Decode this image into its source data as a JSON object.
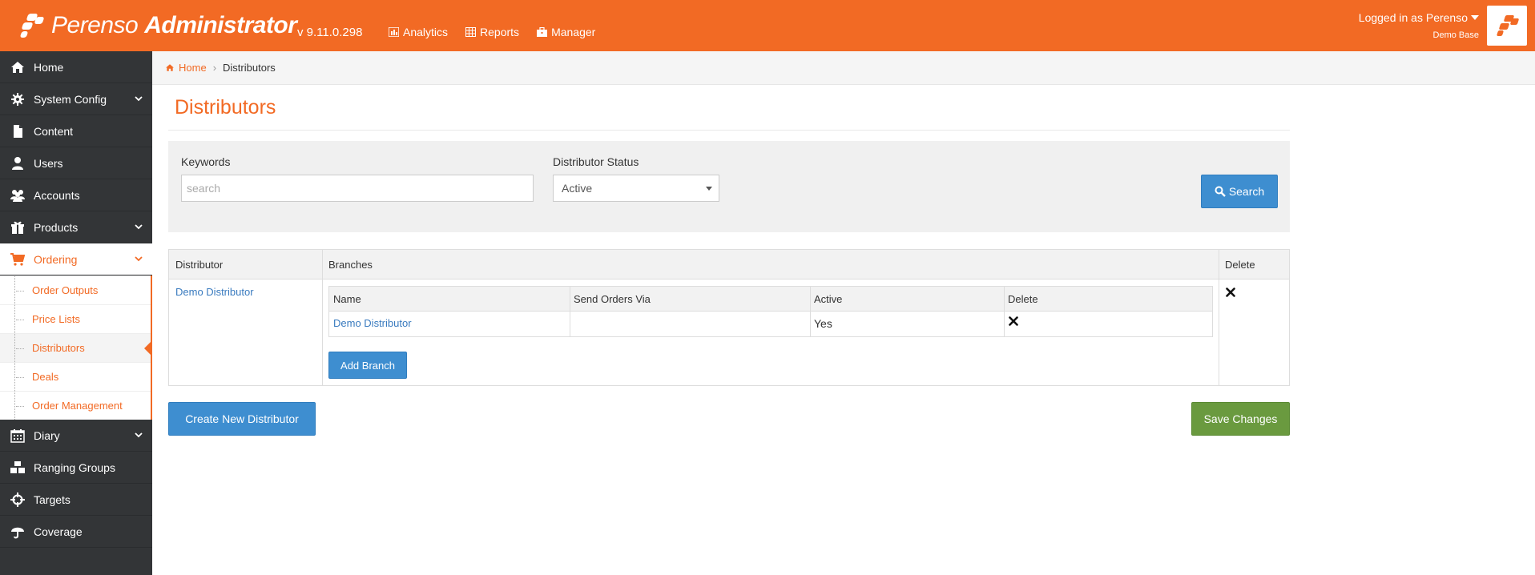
{
  "app": {
    "brand_primary": "Perenso",
    "brand_secondary": "Administrator",
    "version": "v 9.11.0.298",
    "accent_color": "#f26a24"
  },
  "topnav": [
    {
      "label": "Analytics",
      "icon": "bar-chart-icon"
    },
    {
      "label": "Reports",
      "icon": "table-icon"
    },
    {
      "label": "Manager",
      "icon": "briefcase-icon"
    }
  ],
  "user": {
    "logged_in_label": "Logged in as Perenso",
    "base": "Demo Base"
  },
  "sidebar": {
    "items": [
      {
        "label": "Home",
        "icon": "home-icon"
      },
      {
        "label": "System Config",
        "icon": "gear-icon",
        "expandable": true
      },
      {
        "label": "Content",
        "icon": "file-icon"
      },
      {
        "label": "Users",
        "icon": "user-icon"
      },
      {
        "label": "Accounts",
        "icon": "group-icon"
      },
      {
        "label": "Products",
        "icon": "gift-icon",
        "expandable": true
      },
      {
        "label": "Ordering",
        "icon": "cart-icon",
        "expandable": true,
        "active": true
      },
      {
        "label": "Diary",
        "icon": "calendar-icon",
        "expandable": true
      },
      {
        "label": "Ranging Groups",
        "icon": "cubes-icon"
      },
      {
        "label": "Targets",
        "icon": "crosshairs-icon"
      },
      {
        "label": "Coverage",
        "icon": "umbrella-icon"
      }
    ],
    "ordering_submenu": [
      {
        "label": "Order Outputs"
      },
      {
        "label": "Price Lists"
      },
      {
        "label": "Distributors",
        "current": true
      },
      {
        "label": "Deals"
      },
      {
        "label": "Order Management"
      }
    ]
  },
  "breadcrumb": {
    "home": "Home",
    "current": "Distributors"
  },
  "page": {
    "title": "Distributors"
  },
  "filters": {
    "keywords_label": "Keywords",
    "keywords_placeholder": "search",
    "keywords_value": "",
    "status_label": "Distributor Status",
    "status_value": "Active",
    "search_button": "Search"
  },
  "table": {
    "headers": [
      "Distributor",
      "Branches",
      "Delete"
    ],
    "rows": [
      {
        "distributor": "Demo Distributor",
        "branches": {
          "headers": [
            "Name",
            "Send Orders Via",
            "Active",
            "Delete"
          ],
          "rows": [
            {
              "name": "Demo Distributor",
              "send_orders_via": "",
              "active": "Yes"
            }
          ],
          "add_button": "Add Branch"
        }
      }
    ]
  },
  "actions": {
    "create": "Create New Distributor",
    "save": "Save Changes"
  }
}
